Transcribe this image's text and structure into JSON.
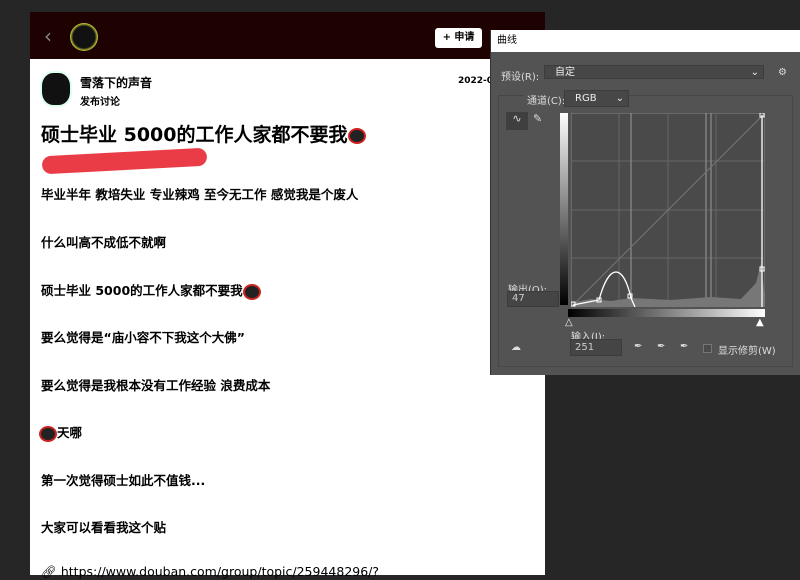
{
  "post": {
    "header": {
      "apply_label": "+ 申请",
      "group_name": "",
      "group_sub": ""
    },
    "author": "雪落下的声音",
    "action": "发布讨论",
    "date": "2022-0",
    "title": "硕士毕业 5000的工作人家都不要我",
    "lines": [
      "毕业半年 教培失业 专业辣鸡 至今无工作 感觉我是个废人",
      "什么叫高不成低不就啊",
      "硕士毕业 5000的工作人家都不要我",
      "要么觉得是“庙小容不下我这个大佛”",
      "要么觉得是我根本没有工作经验 浪费成本",
      "天哪",
      "第一次觉得硕士如此不值钱...",
      "大家可以看看我这个贴",
      "https://www.douban.com/group/topic/259448296/?"
    ]
  },
  "curves": {
    "title": "曲线",
    "preset_label": "预设(R):",
    "preset_value": "自定",
    "channel_label": "通道(C):",
    "channel_value": "RGB",
    "output_label": "输出(O):",
    "output_value": "47",
    "input_label": "输入(I):",
    "input_value": "251",
    "show_clipping_label": "显示修剪(W)",
    "show_clipping_checked": false
  }
}
